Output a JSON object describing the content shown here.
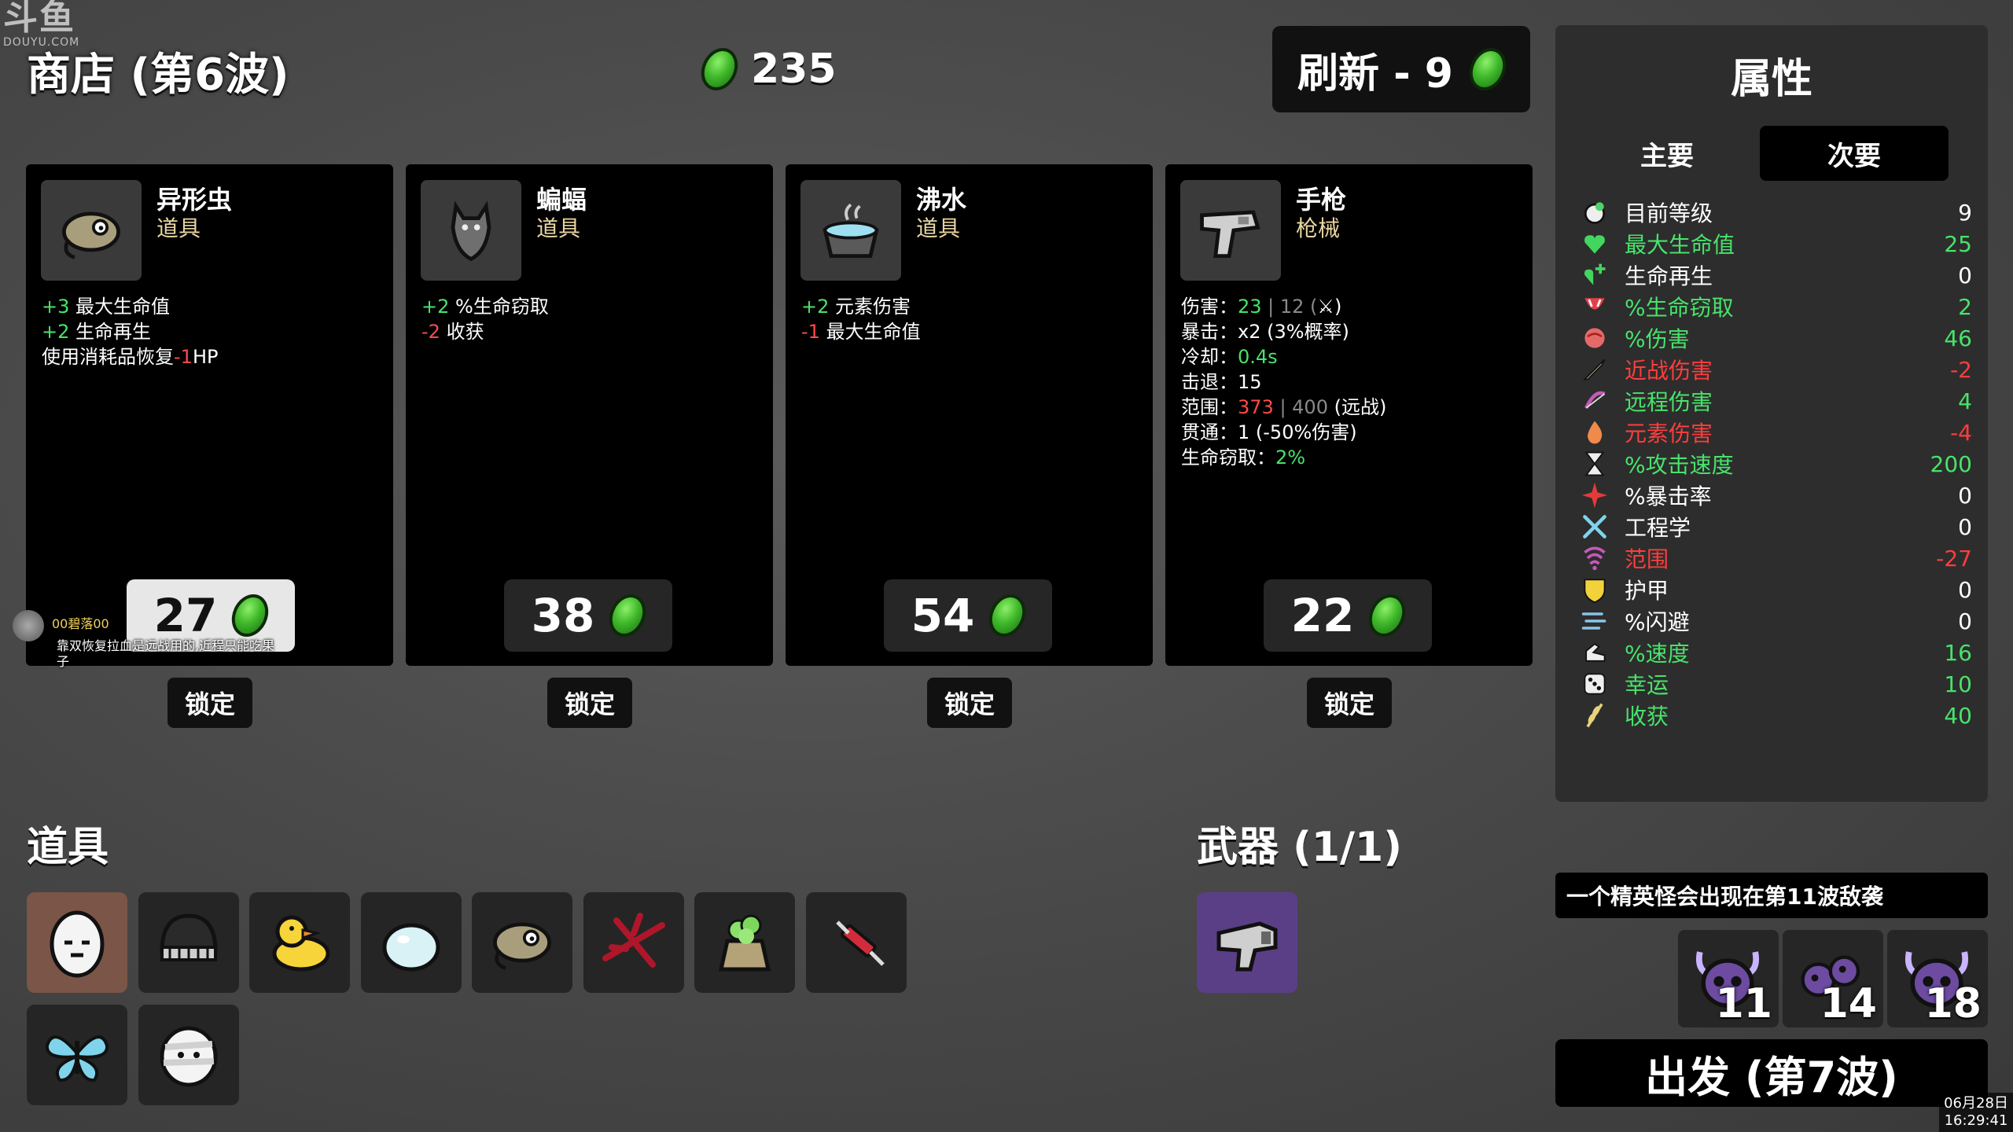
{
  "watermark": {
    "brand": "斗鱼",
    "domain": "DOUYU.COM"
  },
  "shop": {
    "title": "商店 (第6波)",
    "materials": "235"
  },
  "reroll": {
    "label": "刷新 - 9"
  },
  "colors": {
    "positive": "#48e36b",
    "negative": "#ff4a4a",
    "coin_green": "#3fb82a",
    "type_label": "#e9d6a1"
  },
  "cards": [
    {
      "name": "异形虫",
      "type": "道具",
      "icon": "alien-worm-icon",
      "price": "27",
      "lock_label": "锁定",
      "effects": [
        [
          {
            "t": "+3",
            "c": "pos"
          },
          {
            "t": " 最大生命值",
            "c": ""
          }
        ],
        [
          {
            "t": "+2",
            "c": "pos"
          },
          {
            "t": " 生命再生",
            "c": ""
          }
        ],
        [
          {
            "t": "使用消耗品恢复",
            "c": ""
          },
          {
            "t": "-1",
            "c": "neg"
          },
          {
            "t": "HP",
            "c": ""
          }
        ]
      ]
    },
    {
      "name": "蝙蝠",
      "type": "道具",
      "icon": "bat-icon",
      "price": "38",
      "lock_label": "锁定",
      "effects": [
        [
          {
            "t": "+2",
            "c": "pos"
          },
          {
            "t": " %生命窃取",
            "c": ""
          }
        ],
        [
          {
            "t": "-2",
            "c": "neg"
          },
          {
            "t": " 收获",
            "c": ""
          }
        ]
      ]
    },
    {
      "name": "沸水",
      "type": "道具",
      "icon": "boiling-water-icon",
      "price": "54",
      "lock_label": "锁定",
      "effects": [
        [
          {
            "t": "+2",
            "c": "pos"
          },
          {
            "t": " 元素伤害",
            "c": ""
          }
        ],
        [
          {
            "t": "-1",
            "c": "neg"
          },
          {
            "t": " 最大生命值",
            "c": ""
          }
        ]
      ]
    },
    {
      "name": "手枪",
      "type": "枪械",
      "icon": "pistol-icon",
      "price": "22",
      "lock_label": "锁定",
      "effects": [
        [
          {
            "t": "伤害：",
            "c": ""
          },
          {
            "t": "23",
            "c": "pos"
          },
          {
            "t": " | 12 (",
            "c": "dim"
          },
          {
            "t": "⚔",
            "c": ""
          },
          {
            "t": ")",
            "c": ""
          }
        ],
        [
          {
            "t": "暴击：x2 (3%概率)",
            "c": ""
          }
        ],
        [
          {
            "t": "冷却：",
            "c": ""
          },
          {
            "t": "0.4s",
            "c": "pos"
          }
        ],
        [
          {
            "t": "击退：15",
            "c": ""
          }
        ],
        [
          {
            "t": "范围：",
            "c": ""
          },
          {
            "t": "373",
            "c": "neg"
          },
          {
            "t": " | 400",
            "c": "dim"
          },
          {
            "t": " (远战)",
            "c": ""
          }
        ],
        [
          {
            "t": "贯通：1 (-50%伤害)",
            "c": ""
          }
        ],
        [
          {
            "t": "生命窃取：",
            "c": ""
          },
          {
            "t": "2%",
            "c": "pos"
          }
        ]
      ]
    }
  ],
  "chat": {
    "user": "00碧落00",
    "message": "靠双恢复拉血是远战用的,近程只能吃果子"
  },
  "items_section": {
    "title": "道具"
  },
  "items": [
    {
      "icon": "egg-icon",
      "bg": "orange"
    },
    {
      "icon": "helmet-icon",
      "bg": ""
    },
    {
      "icon": "duck-icon",
      "bg": ""
    },
    {
      "icon": "blob-icon",
      "bg": ""
    },
    {
      "icon": "alien-worm-icon",
      "bg": ""
    },
    {
      "icon": "thorn-icon",
      "bg": ""
    },
    {
      "icon": "plant-sack-icon",
      "bg": ""
    },
    {
      "icon": "syringe-icon",
      "bg": ""
    },
    {
      "icon": "butterfly-icon",
      "bg": ""
    },
    {
      "icon": "bandaged-egg-icon",
      "bg": ""
    }
  ],
  "weapons_section": {
    "title": "武器 (1/1)",
    "weapons": [
      {
        "icon": "pistol-icon"
      }
    ]
  },
  "stats": {
    "title": "属性",
    "tab_primary": "主要",
    "tab_secondary": "次要",
    "rows": [
      {
        "label": "目前等级",
        "value": "9",
        "color": "white",
        "icon": "level-icon"
      },
      {
        "label": "最大生命值",
        "value": "25",
        "color": "green",
        "icon": "heart-icon"
      },
      {
        "label": "生命再生",
        "value": "0",
        "color": "white",
        "icon": "regen-icon"
      },
      {
        "label": "%生命窃取",
        "value": "2",
        "color": "green",
        "icon": "lifesteal-icon"
      },
      {
        "label": "%伤害",
        "value": "46",
        "color": "green",
        "icon": "damage-icon"
      },
      {
        "label": "近战伤害",
        "value": "-2",
        "color": "red",
        "icon": "melee-icon"
      },
      {
        "label": "远程伤害",
        "value": "4",
        "color": "green",
        "icon": "ranged-icon"
      },
      {
        "label": "元素伤害",
        "value": "-4",
        "color": "red",
        "icon": "elemental-icon"
      },
      {
        "label": "%攻击速度",
        "value": "200",
        "color": "green",
        "icon": "attack-speed-icon"
      },
      {
        "label": "%暴击率",
        "value": "0",
        "color": "white",
        "icon": "crit-icon"
      },
      {
        "label": "工程学",
        "value": "0",
        "color": "white",
        "icon": "engineering-icon"
      },
      {
        "label": "范围",
        "value": "-27",
        "color": "red",
        "icon": "range-icon"
      },
      {
        "label": "护甲",
        "value": "0",
        "color": "white",
        "icon": "armor-icon"
      },
      {
        "label": "%闪避",
        "value": "0",
        "color": "white",
        "icon": "dodge-icon"
      },
      {
        "label": "%速度",
        "value": "16",
        "color": "green",
        "icon": "speed-icon"
      },
      {
        "label": "幸运",
        "value": "10",
        "color": "green",
        "icon": "luck-icon"
      },
      {
        "label": "收获",
        "value": "40",
        "color": "green",
        "icon": "harvest-icon"
      }
    ]
  },
  "elite": {
    "message": "一个精英怪会出现在第11波敌袭"
  },
  "enemies": [
    {
      "count": "11",
      "icon": "horned-skull-icon"
    },
    {
      "count": "14",
      "icon": "spider-blob-icon"
    },
    {
      "count": "18",
      "icon": "horned-skull-icon"
    }
  ],
  "go_button": {
    "label": "出发 (第7波)"
  },
  "clock": {
    "date": "06月28日",
    "time": "16:29:41"
  }
}
